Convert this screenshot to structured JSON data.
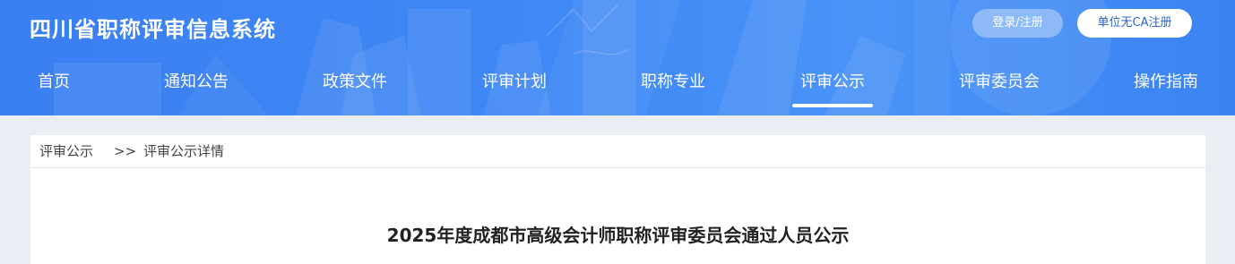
{
  "header": {
    "site_title": "四川省职称评审信息系统",
    "login_label": "登录/注册",
    "unit_register_label": "单位无CA注册",
    "accent_color": "#3f88f5"
  },
  "nav": {
    "items": [
      {
        "label": "首页"
      },
      {
        "label": "通知公告"
      },
      {
        "label": "政策文件"
      },
      {
        "label": "评审计划"
      },
      {
        "label": "职称专业"
      },
      {
        "label": "评审公示",
        "active": true
      },
      {
        "label": "评审委员会"
      },
      {
        "label": "操作指南"
      }
    ]
  },
  "breadcrumb": {
    "items": [
      "评审公示",
      "评审公示详情"
    ],
    "separator": ">>"
  },
  "article": {
    "title": "2025年度成都市高级会计师职称评审委员会通过人员公示"
  }
}
